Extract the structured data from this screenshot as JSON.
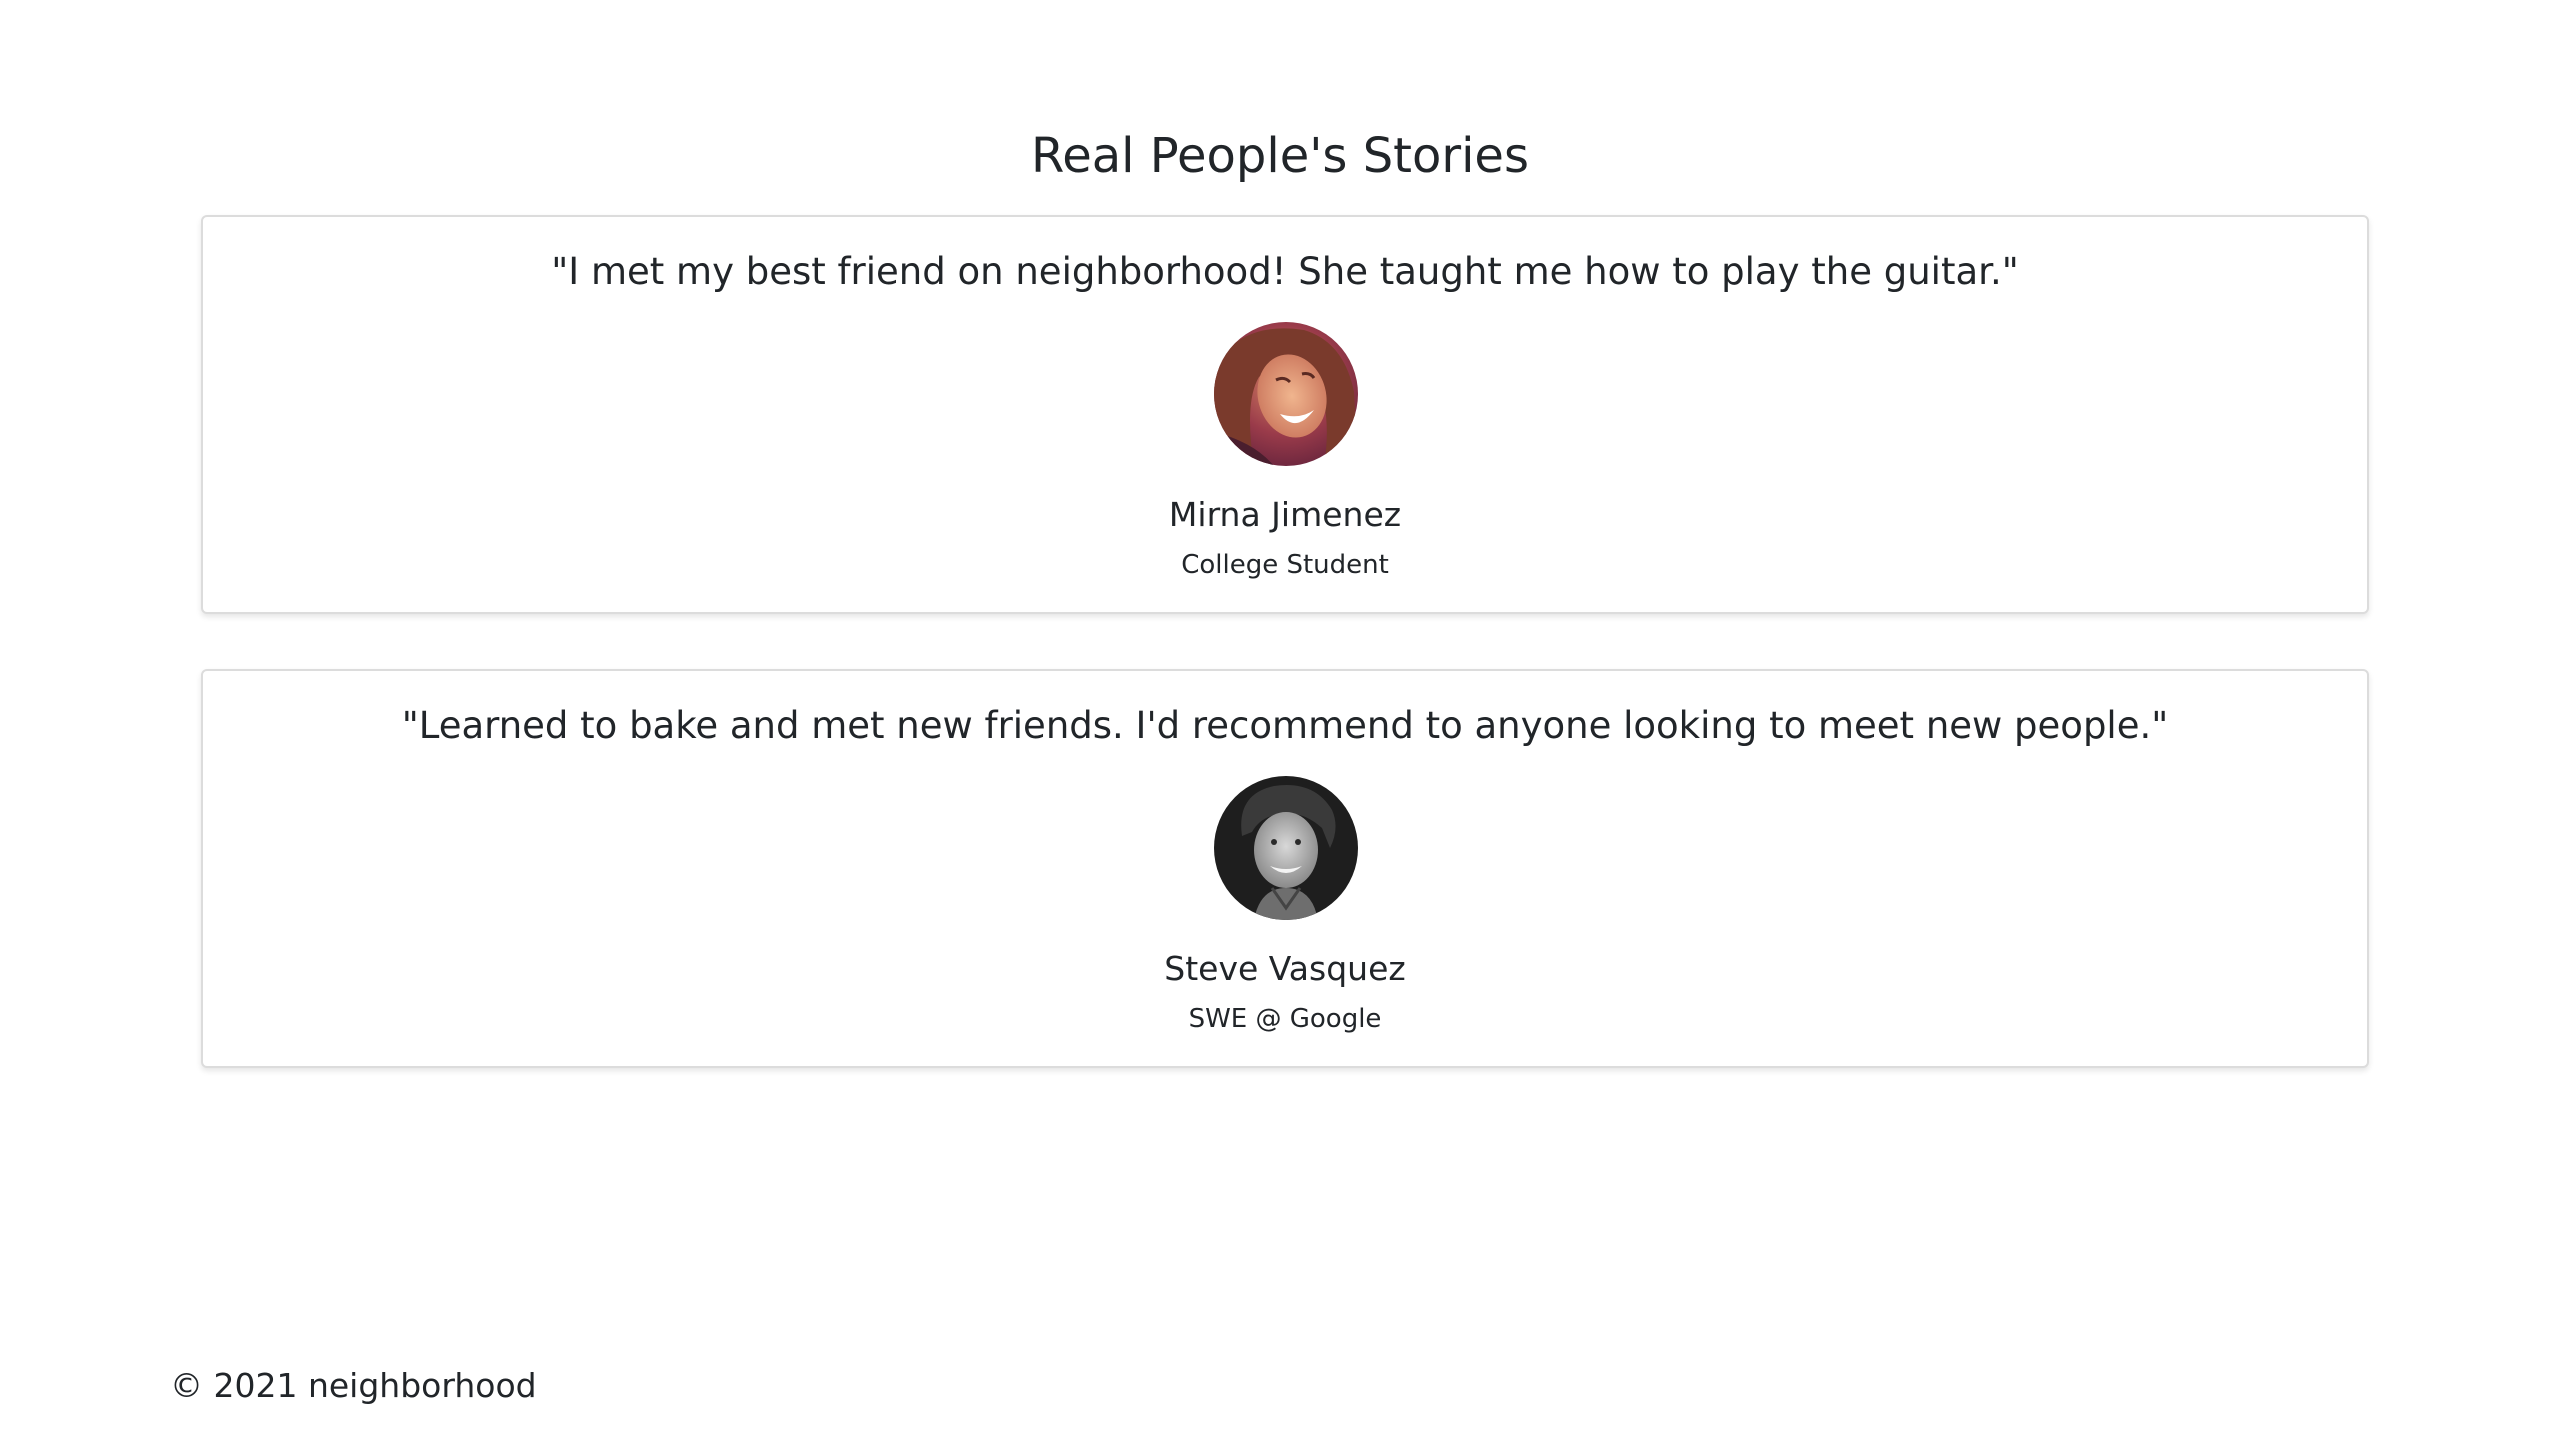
{
  "page": {
    "title": "Real People's Stories"
  },
  "testimonials": [
    {
      "quote": "\"I met my best friend on neighborhood! She taught me how to play the guitar.\"",
      "name": "Mirna Jimenez",
      "role": "College Student",
      "avatar": "laughing-woman-photo"
    },
    {
      "quote": "\"Learned to bake and met new friends. I'd recommend to anyone looking to meet new people.\"",
      "name": "Steve Vasquez",
      "role": "SWE @ Google",
      "avatar": "smiling-man-bw-photo"
    }
  ],
  "footer": {
    "copyright": "© 2021 neighborhood"
  },
  "colors": {
    "text": "#212529",
    "card_border": "#dcdcdc",
    "background": "#ffffff"
  }
}
